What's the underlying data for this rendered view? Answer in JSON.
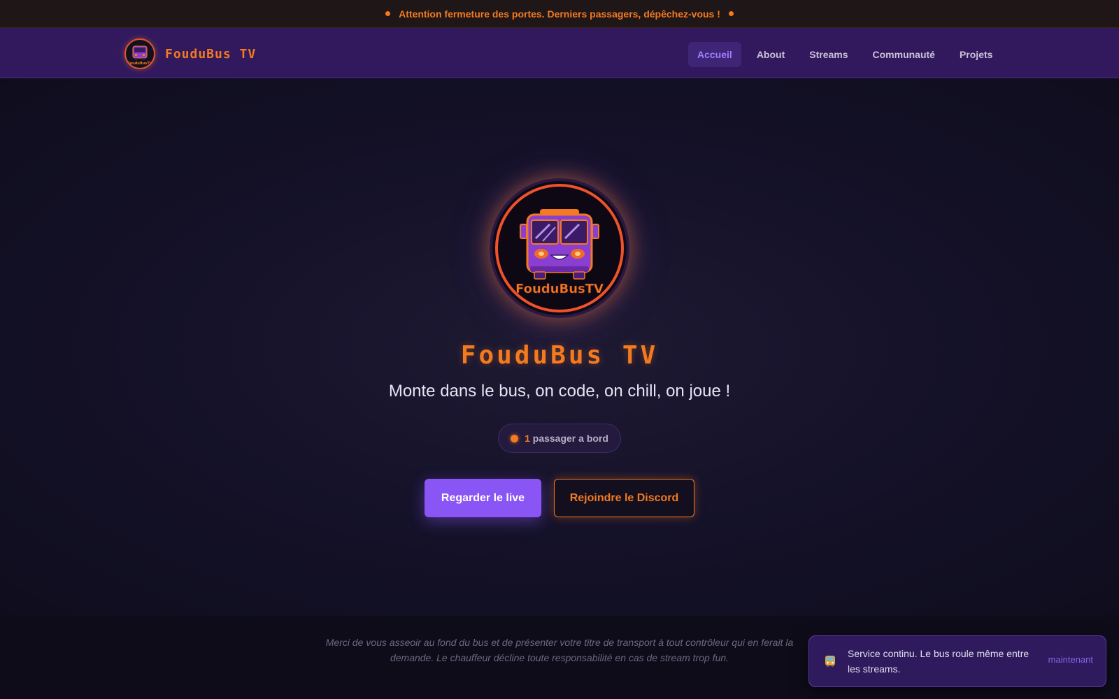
{
  "announcement": {
    "text": "Attention fermeture des portes. Derniers passagers, dépêchez-vous !"
  },
  "brand": {
    "name": "FouduBus TV",
    "logo_text": "FouduBusTV"
  },
  "nav": {
    "items": [
      {
        "label": "Accueil",
        "active": true
      },
      {
        "label": "About",
        "active": false
      },
      {
        "label": "Streams",
        "active": false
      },
      {
        "label": "Communauté",
        "active": false
      },
      {
        "label": "Projets",
        "active": false
      }
    ]
  },
  "hero": {
    "logo_text": "FouduBusTV",
    "title": "FouduBus TV",
    "subtitle": "Monte dans le bus, on code, on chill, on joue !",
    "passengers": {
      "count": "1",
      "label": "passager a bord"
    },
    "primary_button": "Regarder le live",
    "secondary_button": "Rejoindre le Discord"
  },
  "footer": {
    "line1": "Merci de vous asseoir au fond du bus et de présenter votre titre de transport à tout contrôleur qui en ferait la",
    "line2": "demande. Le chauffeur décline toute responsabilité en cas de stream trop fun."
  },
  "toast": {
    "icon": "bus-icon",
    "message": "Service continu. Le bus roule même entre les streams.",
    "time": "maintenant"
  },
  "colors": {
    "accent_orange": "#f37a1f",
    "accent_purple": "#8a55f5",
    "nav_bg": "#32195e",
    "page_bg": "#0e0c1a"
  }
}
